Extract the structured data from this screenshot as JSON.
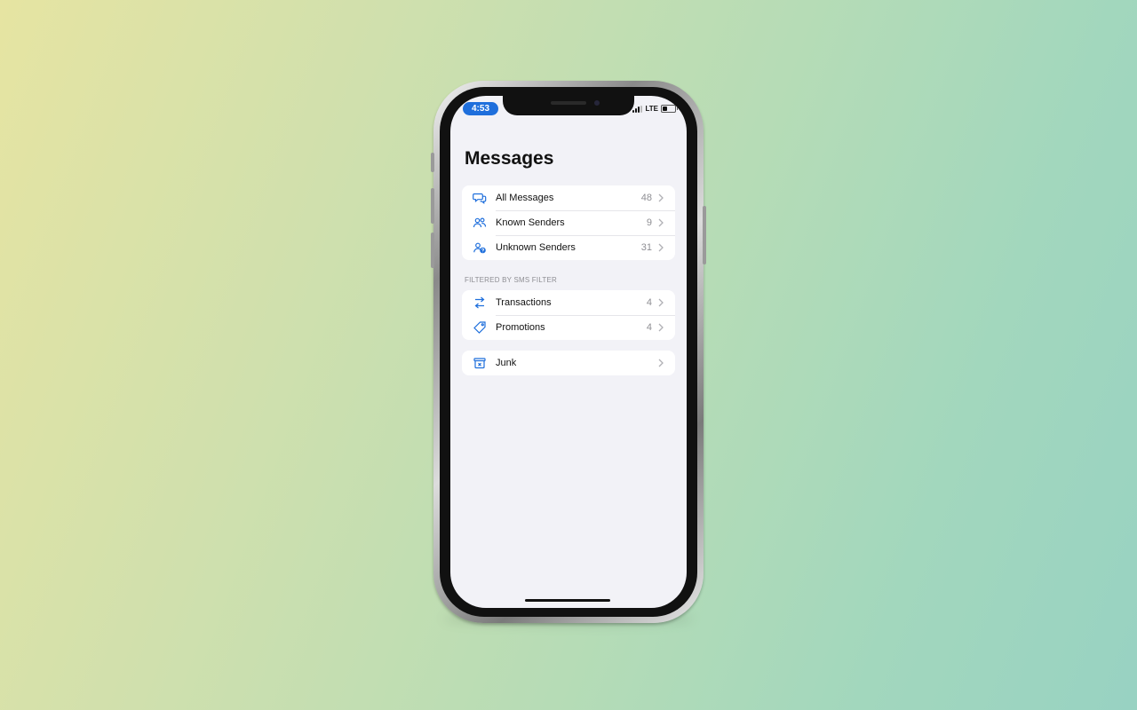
{
  "status_bar": {
    "time": "4:53",
    "network": "LTE",
    "battery_level": 0.4,
    "signal_bars": 3
  },
  "page": {
    "title": "Messages"
  },
  "groups": [
    {
      "header": "",
      "items": [
        {
          "label": "All Messages",
          "count": "48",
          "icon": "chat-bubbles-icon"
        },
        {
          "label": "Known Senders",
          "count": "9",
          "icon": "people-icon"
        },
        {
          "label": "Unknown Senders",
          "count": "31",
          "icon": "unknown-person-icon"
        }
      ]
    },
    {
      "header": "FILTERED BY SMS FILTER",
      "items": [
        {
          "label": "Transactions",
          "count": "4",
          "icon": "arrows-exchange-icon"
        },
        {
          "label": "Promotions",
          "count": "4",
          "icon": "tag-icon"
        }
      ]
    },
    {
      "header": "",
      "items": [
        {
          "label": "Junk",
          "count": "",
          "icon": "junk-bin-icon"
        }
      ]
    }
  ],
  "colors": {
    "accent": "#1f6fdc",
    "background": "#f2f2f7",
    "count_gray": "#8e8e93"
  }
}
